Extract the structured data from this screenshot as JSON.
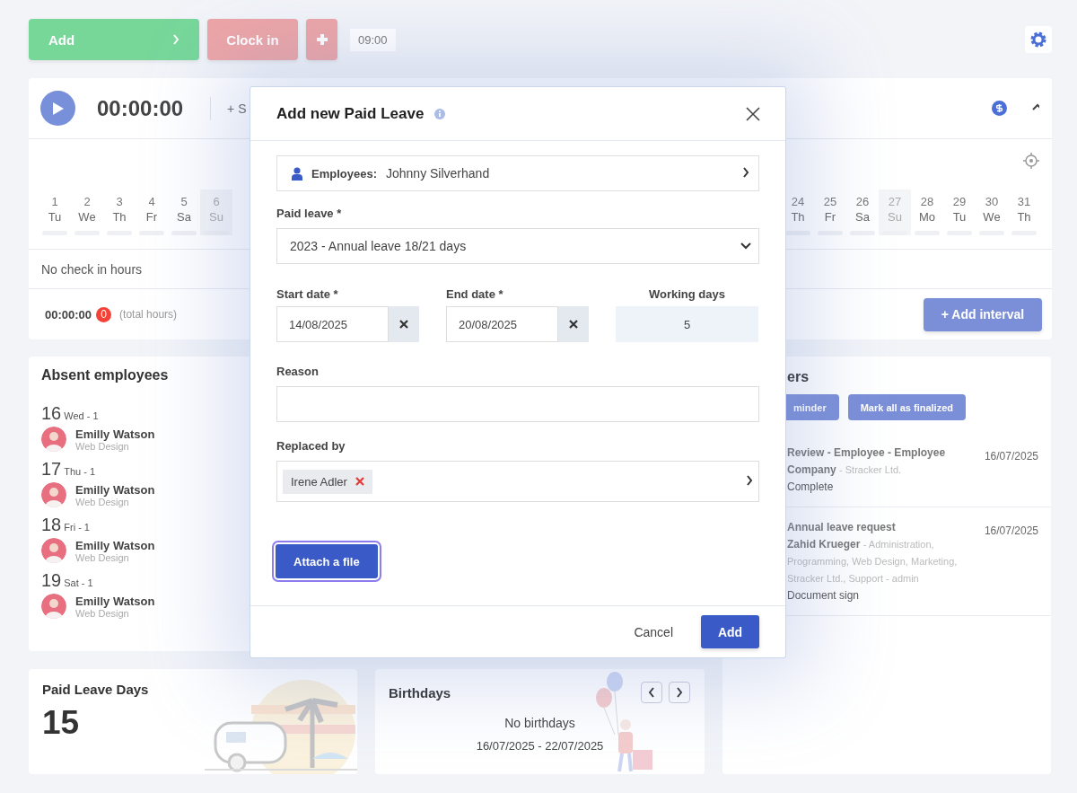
{
  "toolbar": {
    "buttons": [
      {
        "label": "Add",
        "kind": "add"
      },
      {
        "label": "Clock in",
        "kind": "clock"
      },
      {
        "kind": "plus"
      }
    ],
    "time": "09:00"
  },
  "timer": {
    "time": "00:00:00",
    "action": "+ S",
    "days_left": [
      {
        "day": "1",
        "weekday": "Tu",
        "weekend": false
      },
      {
        "day": "2",
        "weekday": "We",
        "weekend": false
      },
      {
        "day": "3",
        "weekday": "Th",
        "weekend": false
      },
      {
        "day": "4",
        "weekday": "Fr",
        "weekend": false
      },
      {
        "day": "5",
        "weekday": "Sa",
        "weekend": false
      },
      {
        "day": "6",
        "weekday": "Su",
        "weekend": true
      }
    ],
    "days_right": [
      {
        "day": "24",
        "weekday": "Th",
        "weekend": false
      },
      {
        "day": "25",
        "weekday": "Fr",
        "weekend": false
      },
      {
        "day": "26",
        "weekday": "Sa",
        "weekend": false
      },
      {
        "day": "27",
        "weekday": "Su",
        "weekend": true
      },
      {
        "day": "28",
        "weekday": "Mo",
        "weekend": false
      },
      {
        "day": "29",
        "weekday": "Tu",
        "weekend": false
      },
      {
        "day": "30",
        "weekday": "We",
        "weekend": false
      },
      {
        "day": "31",
        "weekday": "Th",
        "weekend": false
      }
    ],
    "empty_text": "No check in hours",
    "total": "00:00:00",
    "count": "0",
    "total_hint": "(total hours)",
    "add_button": "+ Add interval"
  },
  "absent": {
    "title": "Absent employees",
    "days": [
      {
        "day": "16",
        "weekday": "Wed - 1",
        "people": [
          {
            "name": "Emilly Watson",
            "team": "Web Design"
          }
        ]
      },
      {
        "day": "17",
        "weekday": "Thu - 1",
        "people": [
          {
            "name": "Emilly Watson",
            "team": "Web Design"
          }
        ]
      },
      {
        "day": "18",
        "weekday": "Fri - 1",
        "people": [
          {
            "name": "Emilly Watson",
            "team": "Web Design"
          }
        ]
      },
      {
        "day": "19",
        "weekday": "Sat - 1",
        "people": [
          {
            "name": "Emilly Watson",
            "team": "Web Design"
          }
        ]
      }
    ]
  },
  "reminders": {
    "title": "ers",
    "buttons": [
      "minder",
      "Mark all as finalized"
    ],
    "items": [
      {
        "title": "Review - Employee - Employee Company",
        "detail": "- Stracker Ltd.",
        "status": "Complete",
        "date": "16/07/2025"
      },
      {
        "title": "Annual leave request",
        "person": "Zahid Krueger",
        "detail": "- Administration, Programming, Web Design, Marketing, Stracker Ltd., Support - admin",
        "status": "Document sign",
        "date": "16/07/2025"
      }
    ]
  },
  "paid_leave_days": {
    "title": "Paid Leave Days",
    "value": "15"
  },
  "birthdays": {
    "title": "Birthdays",
    "empty": "No birthdays",
    "range": "16/07/2025 - 22/07/2025"
  },
  "modal": {
    "title": "Add new Paid Leave",
    "employee_label": "Employees:",
    "employee": "Johnny Silverhand",
    "leave_label": "Paid leave *",
    "leave_value": "2023 - Annual leave 18/21 days",
    "start_label": "Start date *",
    "start": "14/08/2025",
    "end_label": "End date *",
    "end": "20/08/2025",
    "working_label": "Working days",
    "working": "5",
    "reason_label": "Reason",
    "replaced_label": "Replaced by",
    "replaced": [
      {
        "name": "Irene Adler"
      }
    ],
    "attach": "Attach a file",
    "attach_focused": true,
    "cancel": "Cancel",
    "submit": "Add"
  }
}
